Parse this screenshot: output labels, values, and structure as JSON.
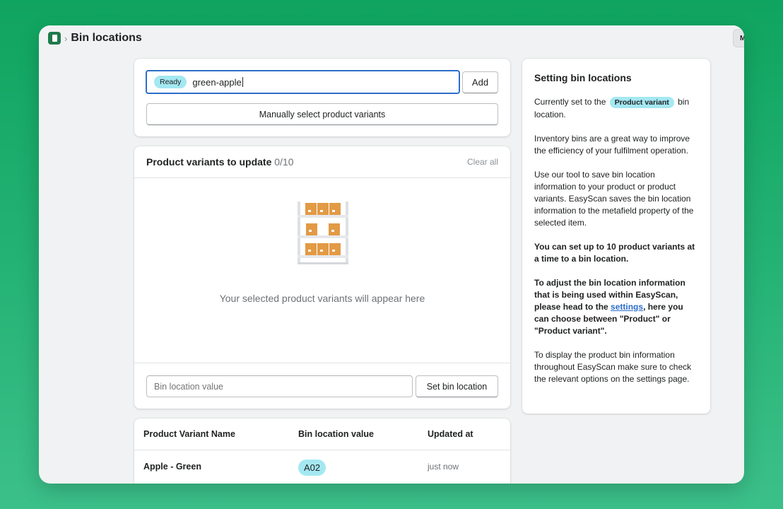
{
  "header": {
    "title": "Bin locations",
    "breadcrumb_sep": "›",
    "corner_label": "M"
  },
  "search": {
    "status": "Ready",
    "value": "green-apple",
    "add_label": "Add",
    "manual_label": "Manually select product variants"
  },
  "variants": {
    "title": "Product variants to update",
    "count": "0/10",
    "clear_label": "Clear all",
    "empty_text": "Your selected product variants will appear here",
    "bin_placeholder": "Bin location value",
    "set_label": "Set bin location"
  },
  "table": {
    "headers": [
      "Product Variant Name",
      "Bin location value",
      "Updated at"
    ],
    "rows": [
      {
        "name": "Apple - Green",
        "bin": "A02",
        "updated": "just now"
      }
    ]
  },
  "help": {
    "title": "Setting bin locations",
    "p1_before": "Currently set to the",
    "p1_badge": "Product variant",
    "p1_after": "bin location.",
    "p2": "Inventory bins are a great way to improve the efficiency of your fulfilment operation.",
    "p3": "Use our tool to save bin location information to your product or product variants. EasyScan saves the bin location information to the metafield property of the selected item.",
    "p4": "You can set up to 10 product variants at a time to a bin location.",
    "p5_before": "To adjust the bin location information that is being used within EasyScan, please head to the",
    "p5_link": "settings",
    "p5_after": ", here you can choose between \"Product\" or \"Product variant\".",
    "p6": "To display the product bin information throughout EasyScan make sure to check the relevant options on the settings page."
  },
  "colors": {
    "background": "#0fa45f",
    "badge": "#a4e8f2",
    "focus": "#2c6ecb",
    "box": "#e29a45"
  },
  "icons": [
    "app-logo-icon",
    "empty-shelf-illustration"
  ]
}
